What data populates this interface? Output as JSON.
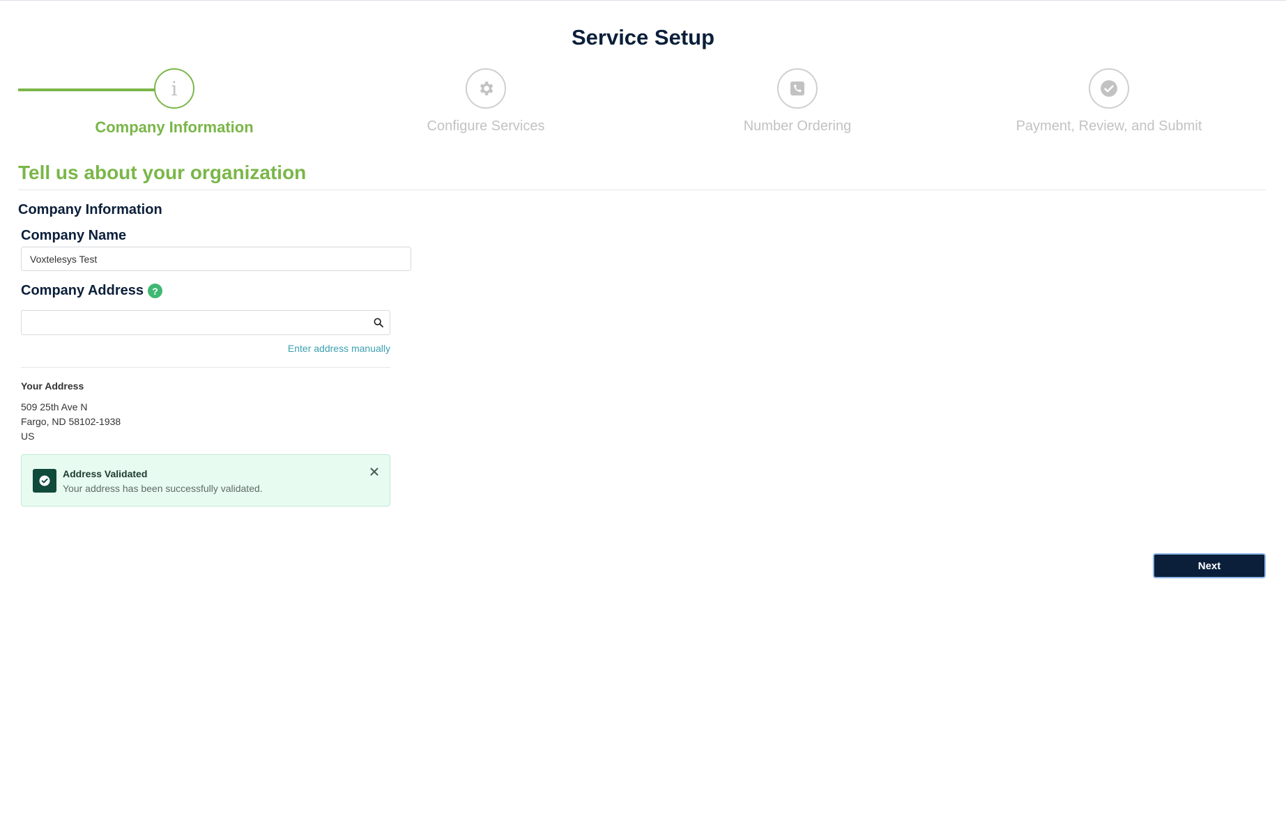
{
  "page": {
    "title": "Service Setup"
  },
  "stepper": {
    "steps": [
      {
        "label": "Company Information",
        "icon": "info-icon",
        "active": true
      },
      {
        "label": "Configure Services",
        "icon": "gear-icon",
        "active": false
      },
      {
        "label": "Number Ordering",
        "icon": "phone-icon",
        "active": false
      },
      {
        "label": "Payment, Review, and Submit",
        "icon": "check-circle-icon",
        "active": false
      }
    ]
  },
  "form": {
    "section_title": "Tell us about your organization",
    "sub_heading": "Company Information",
    "company_name": {
      "label": "Company Name",
      "value": "Voxtelesys Test"
    },
    "company_address": {
      "label": "Company Address",
      "help_icon": "?",
      "search_value": "",
      "manual_link": "Enter address manually"
    },
    "your_address": {
      "label": "Your Address",
      "line1": "509 25th Ave N",
      "line2": "Fargo, ND 58102-1938",
      "line3": "US"
    },
    "alert": {
      "title": "Address Validated",
      "message": "Your address has been successfully validated."
    }
  },
  "actions": {
    "next_label": "Next"
  },
  "colors": {
    "accent": "#7ab648",
    "navy": "#0b1f3a",
    "success_bg": "#e8fbf1"
  }
}
